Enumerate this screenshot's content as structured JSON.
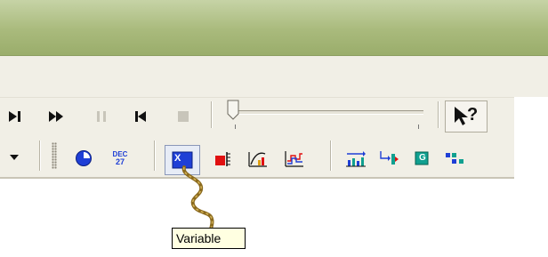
{
  "colors": {
    "titlebar": "#a9ba7c",
    "toolbar_bg": "#f1efe6",
    "tooltip_bg": "#ffffe1",
    "accent_blue": "#1f3fd6",
    "accent_red": "#e01010",
    "accent_teal": "#10a090",
    "cord": "#8b6a1e"
  },
  "playback": {
    "icons": [
      "step-forward-icon",
      "fast-forward-icon",
      "pause-icon",
      "step-back-icon",
      "stop-icon"
    ],
    "slider_position": 0.0
  },
  "help": {
    "icon": "whats-this-help-icon",
    "label": "?"
  },
  "toolbar2": {
    "icons": [
      "dropdown-arrow-icon",
      "clock-icon",
      "date-icon",
      "variable-icon",
      "gauge-icon",
      "histogram-icon",
      "trend-chart-icon",
      "bar-chart-icon",
      "flow-arrow-icon",
      "teal-g-icon",
      "connector-icon"
    ],
    "date_month": "DEC",
    "date_day": "27",
    "variable_letter": "X",
    "teal_letter": "G"
  },
  "tooltip": {
    "text": "Variable"
  }
}
